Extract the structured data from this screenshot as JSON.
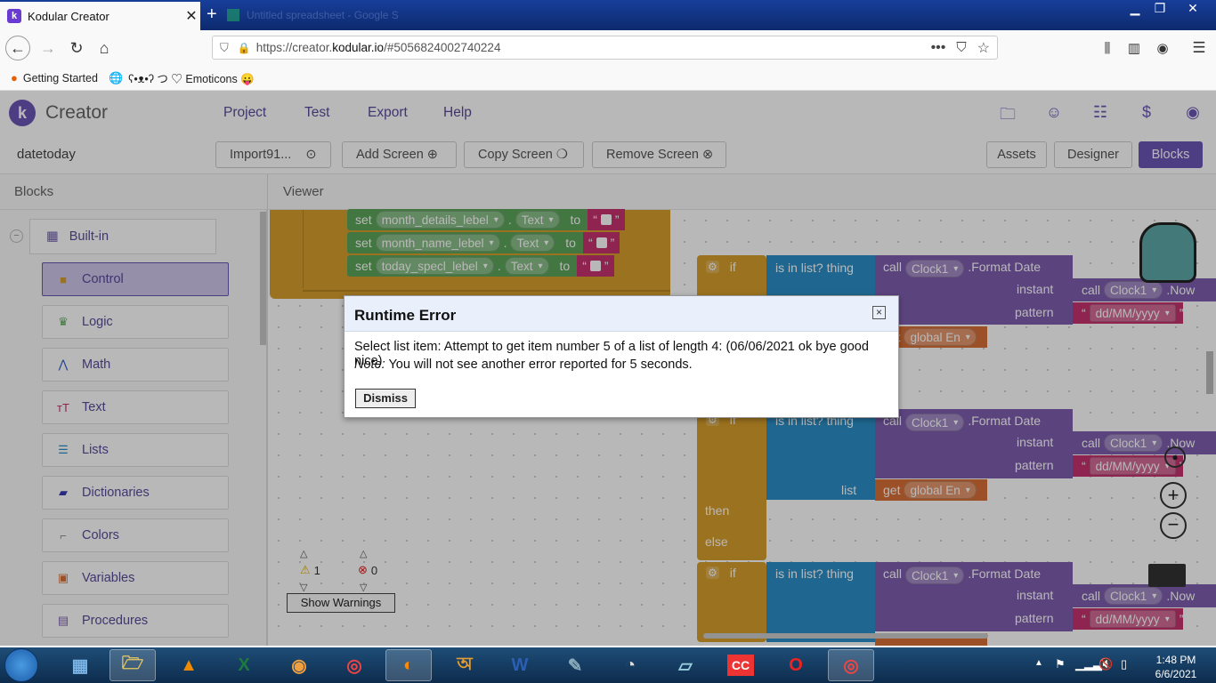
{
  "browser": {
    "tab_title": "Kodular Creator",
    "tab_favicon": "k",
    "tab2_title": "Untitled spreadsheet - Google S",
    "url_prefix": "https://creator.",
    "url_domain": "kodular.io",
    "url_suffix": "/#5056824002740224",
    "bookmarks": [
      {
        "label": "Getting Started",
        "icon": "firefox-icon"
      },
      {
        "label": "ʕ•ᴥ•ʔ つ ♡ Emoticons 😛",
        "icon": "globe-icon"
      }
    ]
  },
  "app": {
    "logo_letter": "k",
    "brand": "Creator",
    "menu": [
      "Project",
      "Test",
      "Export",
      "Help"
    ],
    "project_name": "datetoday",
    "screen_select": "Import91...",
    "add_screen": "Add Screen ⊕",
    "copy_screen": "Copy Screen ❍",
    "remove_screen": "Remove Screen ⊗",
    "assets": "Assets",
    "designer": "Designer",
    "blocks": "Blocks"
  },
  "panel": {
    "blocks_title": "Blocks",
    "viewer_title": "Viewer",
    "builtin": "Built-in",
    "categories": [
      {
        "label": "Control",
        "color": "#d79f2c",
        "icon": "■"
      },
      {
        "label": "Logic",
        "color": "#5da55a",
        "icon": "♛"
      },
      {
        "label": "Math",
        "color": "#2c5ec8",
        "icon": "⋀"
      },
      {
        "label": "Text",
        "color": "#c5326e",
        "icon": "ᴛT"
      },
      {
        "label": "Lists",
        "color": "#2c8fc8",
        "icon": "☰"
      },
      {
        "label": "Dictionaries",
        "color": "#3a3ab0",
        "icon": "▰"
      },
      {
        "label": "Colors",
        "color": "#888888",
        "icon": "⌐"
      },
      {
        "label": "Variables",
        "color": "#d97038",
        "icon": "▣"
      },
      {
        "label": "Procedures",
        "color": "#7e5fae",
        "icon": "▤"
      }
    ]
  },
  "blocks": {
    "set": "set",
    "to": "to",
    "dot": ".",
    "text_prop": "Text",
    "rows": [
      "month_details_lebel",
      "month_name_lebel",
      "today_specl_lebel"
    ],
    "if": "if",
    "then": "then",
    "else": "else",
    "is_in_list": "is in list? thing",
    "list": "list",
    "call": "call",
    "clock": "Clock1",
    "format_date": ".Format Date",
    "instant": "instant",
    "pattern": "pattern",
    "now": ".Now",
    "pattern_value": "dd/MM/yyyy",
    "get": "get",
    "global_en": "global En",
    "warnings_count": "1",
    "errors_count": "0",
    "show_warnings": "Show Warnings"
  },
  "dialog": {
    "title": "Runtime Error",
    "message": "Select list item: Attempt to get item number 5 of a list of length 4: (06/06/2021 ok bye good nice)",
    "note_label": "Note:",
    "note_text": " You will not see another error reported for 5 seconds.",
    "dismiss": "Dismiss",
    "close": "×"
  },
  "taskbar": {
    "time": "1:48 PM",
    "date": "6/6/2021"
  }
}
